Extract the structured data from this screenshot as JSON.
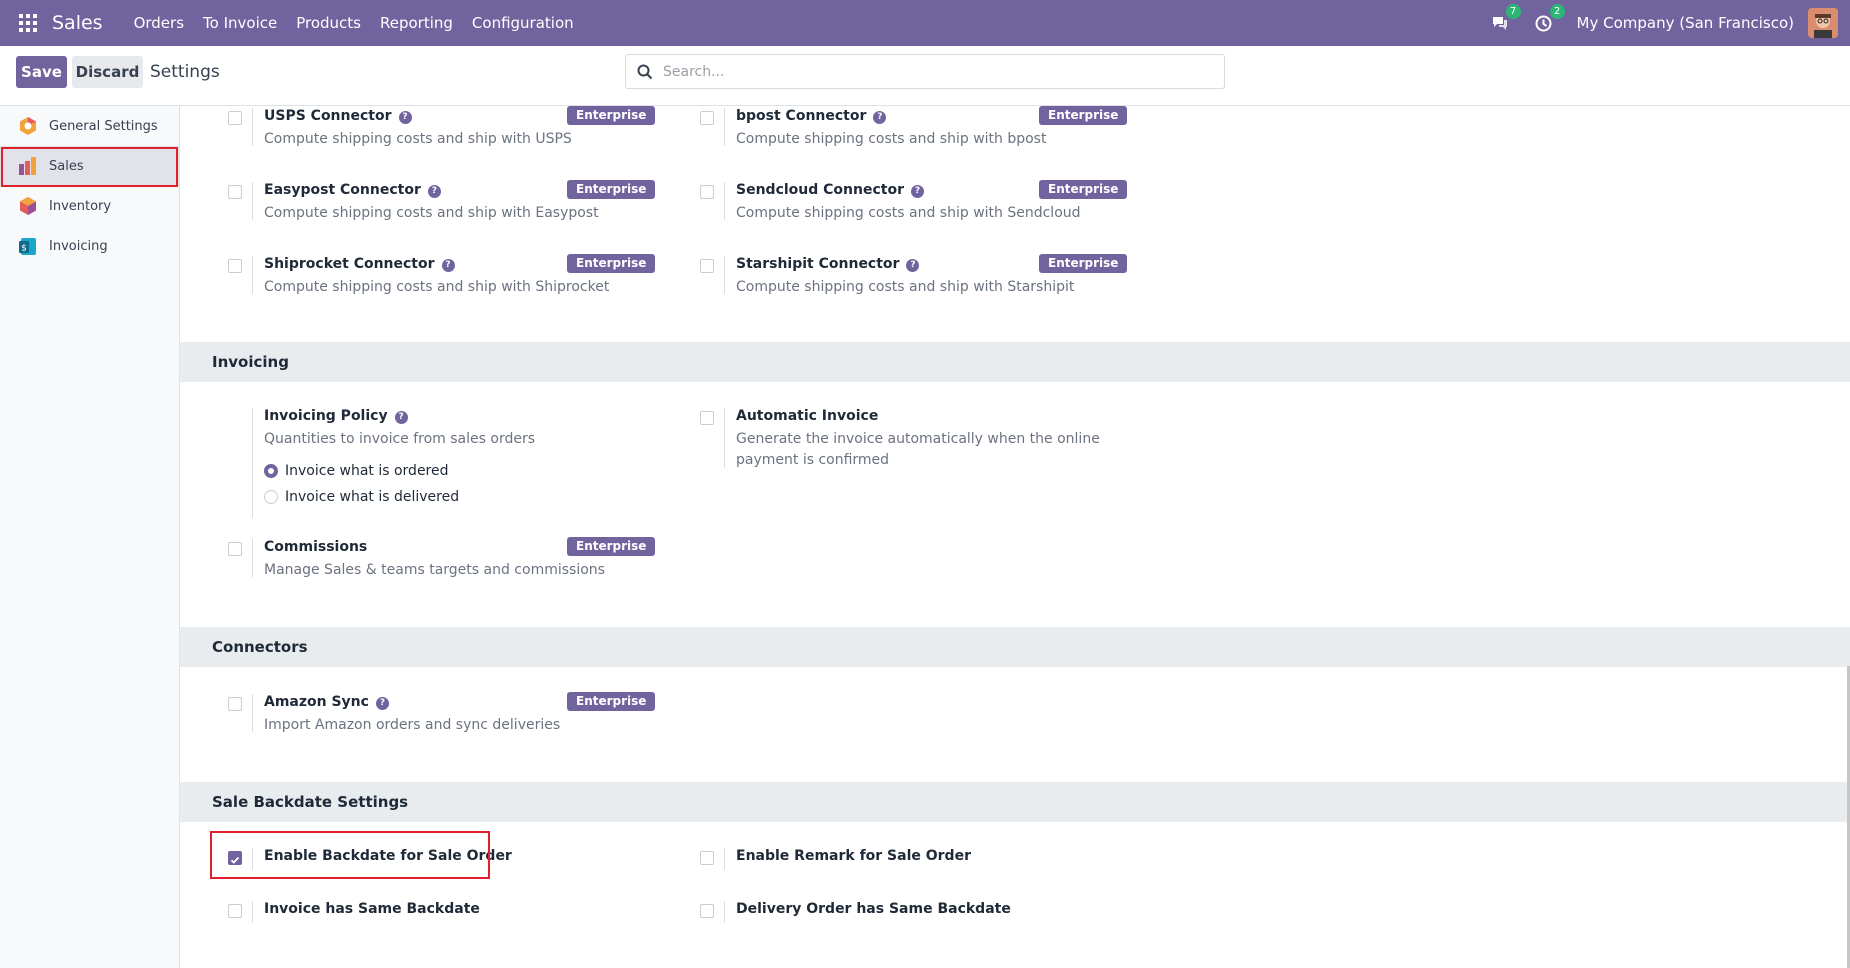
{
  "navbar": {
    "app_name": "Sales",
    "menus": [
      "Orders",
      "To Invoice",
      "Products",
      "Reporting",
      "Configuration"
    ],
    "messages_count": "7",
    "activities_count": "2",
    "company": "My Company (San Francisco)"
  },
  "control_panel": {
    "save_label": "Save",
    "discard_label": "Discard",
    "title": "Settings",
    "search_placeholder": "Search..."
  },
  "sidebar": {
    "items": [
      {
        "label": "General Settings",
        "icon": "odoo-settings-icon"
      },
      {
        "label": "Sales",
        "icon": "sales-app-icon",
        "active": true
      },
      {
        "label": "Inventory",
        "icon": "inventory-app-icon"
      },
      {
        "label": "Invoicing",
        "icon": "invoicing-app-icon"
      }
    ]
  },
  "shipping": {
    "usps": {
      "title": "USPS Connector",
      "desc": "Compute shipping costs and ship with USPS",
      "badge": "Enterprise"
    },
    "bpost": {
      "title": "bpost Connector",
      "desc": "Compute shipping costs and ship with bpost",
      "badge": "Enterprise"
    },
    "easypost": {
      "title": "Easypost Connector",
      "desc": "Compute shipping costs and ship with Easypost",
      "badge": "Enterprise"
    },
    "sendcloud": {
      "title": "Sendcloud Connector",
      "desc": "Compute shipping costs and ship with Sendcloud",
      "badge": "Enterprise"
    },
    "shiprocket": {
      "title": "Shiprocket Connector",
      "desc": "Compute shipping costs and ship with Shiprocket",
      "badge": "Enterprise"
    },
    "starshipit": {
      "title": "Starshipit Connector",
      "desc": "Compute shipping costs and ship with Starshipit",
      "badge": "Enterprise"
    }
  },
  "invoicing": {
    "heading": "Invoicing",
    "policy": {
      "title": "Invoicing Policy",
      "desc": "Quantities to invoice from sales orders",
      "options": [
        "Invoice what is ordered",
        "Invoice what is delivered"
      ],
      "selected": "Invoice what is ordered"
    },
    "automatic": {
      "title": "Automatic Invoice",
      "desc": "Generate the invoice automatically when the online payment is confirmed"
    },
    "commissions": {
      "title": "Commissions",
      "desc": "Manage Sales & teams targets and commissions",
      "badge": "Enterprise"
    }
  },
  "connectors": {
    "heading": "Connectors",
    "amazon": {
      "title": "Amazon Sync",
      "desc": "Import Amazon orders and sync deliveries",
      "badge": "Enterprise"
    }
  },
  "backdate": {
    "heading": "Sale Backdate Settings",
    "enable_backdate": {
      "title": "Enable Backdate for Sale Order",
      "checked": true
    },
    "enable_remark": {
      "title": "Enable Remark for Sale Order",
      "checked": false
    },
    "invoice_same": {
      "title": "Invoice has Same Backdate",
      "checked": false
    },
    "delivery_same": {
      "title": "Delivery Order has Same Backdate",
      "checked": false
    }
  },
  "colors": {
    "brand": "#71639e",
    "highlight": "#e0202a",
    "badge_green": "#2bb673"
  }
}
